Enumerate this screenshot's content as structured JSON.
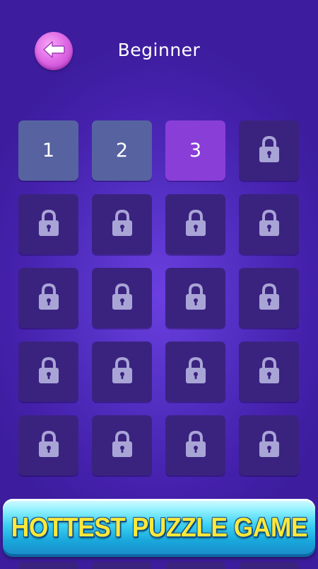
{
  "header": {
    "title": "Beginner",
    "back_icon": "back-arrow-icon"
  },
  "colors": {
    "background": "#4521ad",
    "tile_locked": "#3a237f",
    "tile_completed": "#5763a0",
    "tile_current": "#8a3ed8",
    "lock_icon": "#a9a4d6",
    "back_button": "#e06be6",
    "banner_text": "#ffe83a"
  },
  "levels": [
    {
      "label": "1",
      "state": "completed"
    },
    {
      "label": "2",
      "state": "completed"
    },
    {
      "label": "3",
      "state": "current"
    },
    {
      "label": "",
      "state": "locked"
    },
    {
      "label": "",
      "state": "locked"
    },
    {
      "label": "",
      "state": "locked"
    },
    {
      "label": "",
      "state": "locked"
    },
    {
      "label": "",
      "state": "locked"
    },
    {
      "label": "",
      "state": "locked"
    },
    {
      "label": "",
      "state": "locked"
    },
    {
      "label": "",
      "state": "locked"
    },
    {
      "label": "",
      "state": "locked"
    },
    {
      "label": "",
      "state": "locked"
    },
    {
      "label": "",
      "state": "locked"
    },
    {
      "label": "",
      "state": "locked"
    },
    {
      "label": "",
      "state": "locked"
    },
    {
      "label": "",
      "state": "locked"
    },
    {
      "label": "",
      "state": "locked"
    },
    {
      "label": "",
      "state": "locked"
    },
    {
      "label": "",
      "state": "locked"
    }
  ],
  "banner": {
    "text": "HOTTEST PUZZLE GAME"
  }
}
